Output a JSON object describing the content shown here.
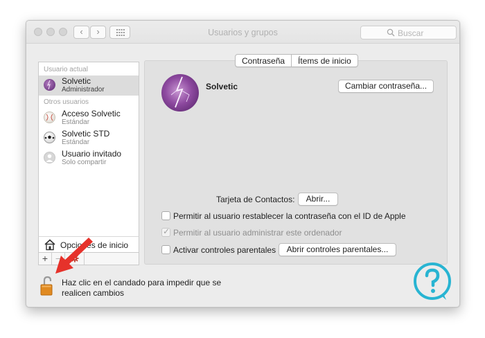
{
  "window": {
    "title": "Usuarios y grupos"
  },
  "toolbar_nav": {
    "back_glyph": "‹",
    "forward_glyph": "›"
  },
  "search": {
    "placeholder": "Buscar"
  },
  "sidebar": {
    "current_user_header": "Usuario actual",
    "current_user": {
      "name": "Solvetic",
      "role": "Administrador"
    },
    "other_users_header": "Otros usuarios",
    "other_users": [
      {
        "name": "Acceso Solvetic",
        "role": "Estándar"
      },
      {
        "name": "Solvetic STD",
        "role": "Estándar"
      },
      {
        "name": "Usuario invitado",
        "role": "Solo compartir"
      }
    ],
    "login_options_label": "Opciones de inicio",
    "add_glyph": "+",
    "remove_glyph": "−"
  },
  "tabs": [
    {
      "label": "Contraseña",
      "selected": true
    },
    {
      "label": "Ítems de inicio",
      "selected": false
    }
  ],
  "user_panel": {
    "name": "Solvetic",
    "change_password_button": "Cambiar contraseña...",
    "contacts_card_label": "Tarjeta de Contactos:",
    "open_button": "Abrir...",
    "options": [
      {
        "label": "Permitir al usuario restablecer la contraseña con el ID de Apple",
        "checked": false,
        "enabled": true
      },
      {
        "label": "Permitir al usuario administrar este ordenador",
        "checked": true,
        "enabled": false
      },
      {
        "label": "Activar controles parentales",
        "checked": false,
        "enabled": true
      }
    ],
    "parental_controls_button": "Abrir controles parentales..."
  },
  "lock": {
    "line1": "Haz clic en el candado para impedir que se",
    "line2": "realicen cambios"
  },
  "icons": {
    "gear": "gear-icon",
    "lock": "lock-open-icon",
    "home": "house-icon",
    "search": "search-icon",
    "grid": "grid-icon"
  },
  "colors": {
    "selection": "#dcdcdc",
    "avatar_purple": "#7a3c8c",
    "arrow_red": "#e6322b",
    "watermark_cyan": "#28b4d2",
    "lock_orange": "#e08a21"
  }
}
